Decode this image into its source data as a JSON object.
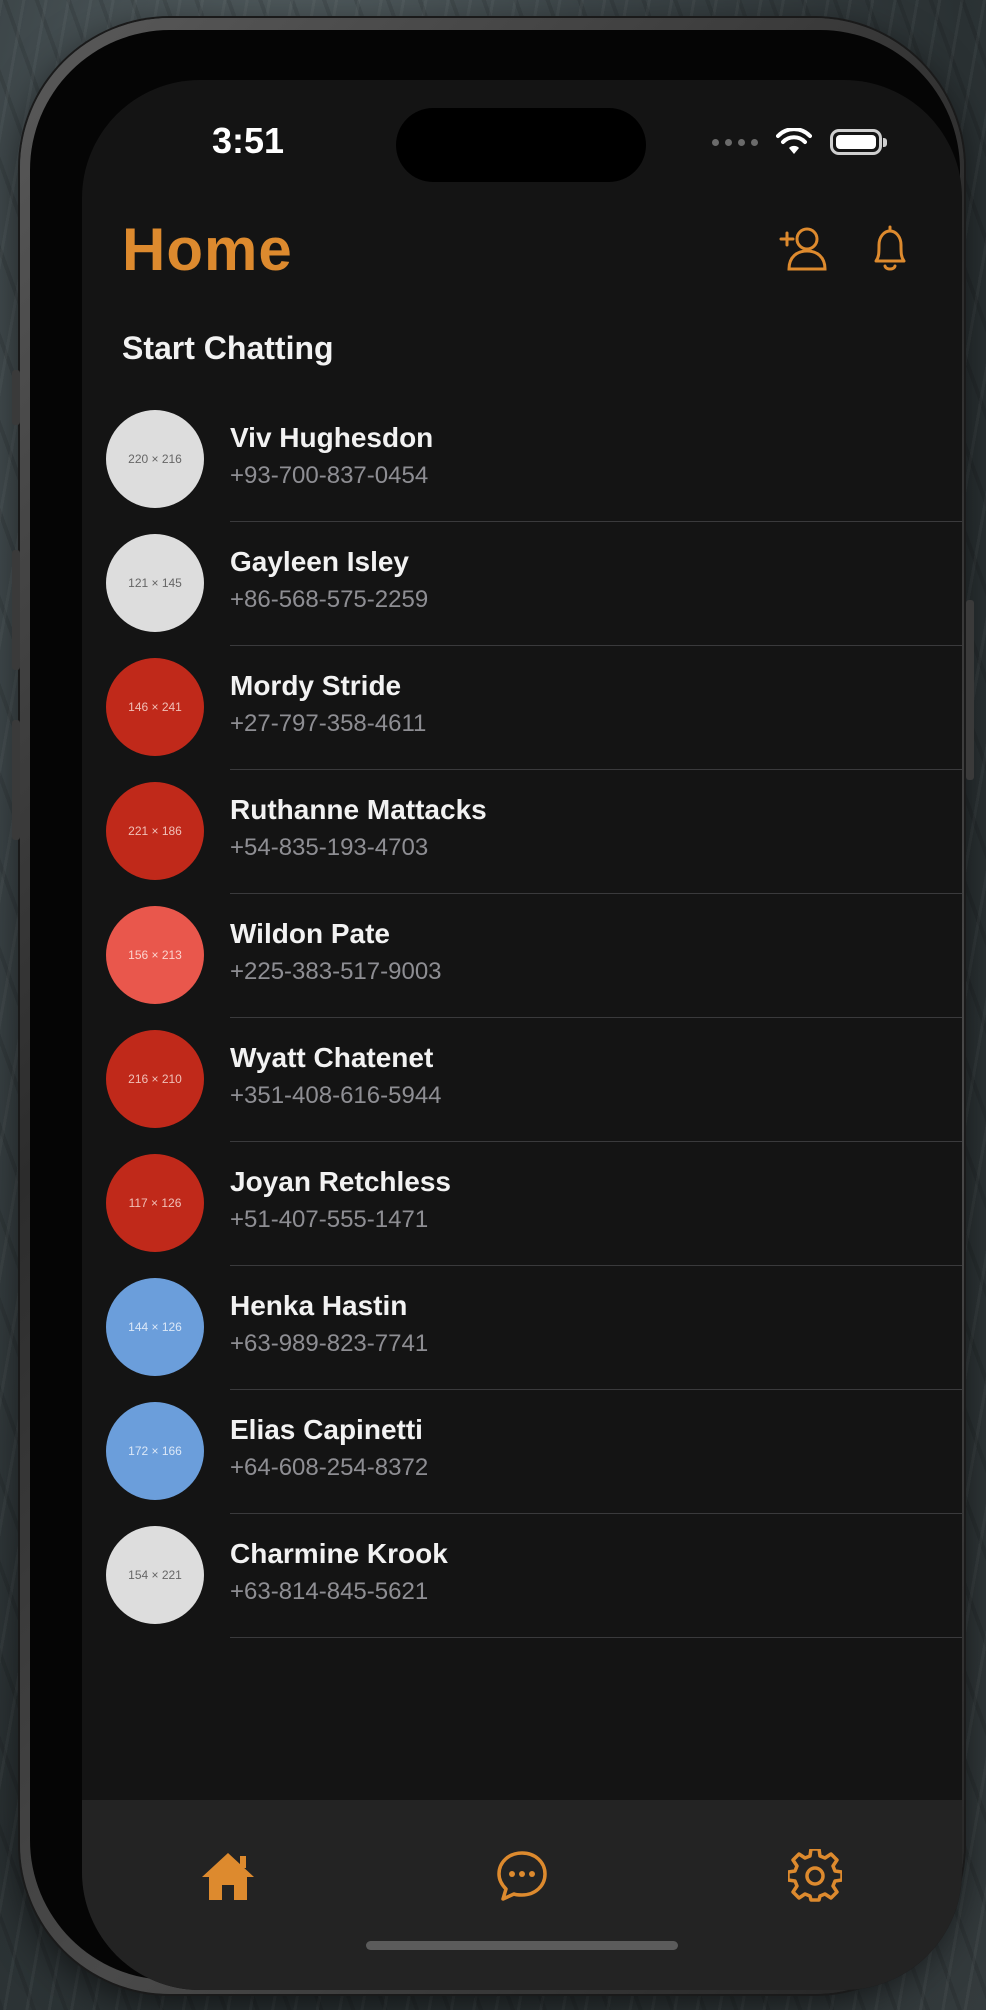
{
  "status_bar": {
    "time": "3:51"
  },
  "header": {
    "title": "Home",
    "icons": [
      "add-person-icon",
      "bell-icon"
    ],
    "accent_color": "#DD8A2E"
  },
  "section": {
    "title": "Start Chatting"
  },
  "contacts": [
    {
      "name": "Viv Hughesdon",
      "phone": "+93-700-837-0454",
      "avatar_label": "220 × 216",
      "avatar_color": "#DDDDDD",
      "avatar_text_color": "#666666"
    },
    {
      "name": "Gayleen Isley",
      "phone": "+86-568-575-2259",
      "avatar_label": "121 × 145",
      "avatar_color": "#DDDDDD",
      "avatar_text_color": "#666666"
    },
    {
      "name": "Mordy Stride",
      "phone": "+27-797-358-4611",
      "avatar_label": "146 × 241",
      "avatar_color": "#C0291A",
      "avatar_text_color": "#F0C0B8"
    },
    {
      "name": "Ruthanne Mattacks",
      "phone": "+54-835-193-4703",
      "avatar_label": "221 × 186",
      "avatar_color": "#C0291A",
      "avatar_text_color": "#F0C0B8"
    },
    {
      "name": "Wildon Pate",
      "phone": "+225-383-517-9003",
      "avatar_label": "156 × 213",
      "avatar_color": "#E9574C",
      "avatar_text_color": "#FBD4CF"
    },
    {
      "name": "Wyatt Chatenet",
      "phone": "+351-408-616-5944",
      "avatar_label": "216 × 210",
      "avatar_color": "#C0291A",
      "avatar_text_color": "#F0C0B8"
    },
    {
      "name": "Joyan Retchless",
      "phone": "+51-407-555-1471",
      "avatar_label": "117 × 126",
      "avatar_color": "#C0291A",
      "avatar_text_color": "#F0C0B8"
    },
    {
      "name": "Henka Hastin",
      "phone": "+63-989-823-7741",
      "avatar_label": "144 × 126",
      "avatar_color": "#6B9EDB",
      "avatar_text_color": "#DCE8F7"
    },
    {
      "name": "Elias Capinetti",
      "phone": "+64-608-254-8372",
      "avatar_label": "172 × 166",
      "avatar_color": "#6B9EDB",
      "avatar_text_color": "#DCE8F7"
    },
    {
      "name": "Charmine Krook",
      "phone": "+63-814-845-5621",
      "avatar_label": "154 × 221",
      "avatar_color": "#DDDDDD",
      "avatar_text_color": "#666666"
    }
  ],
  "tab_bar": {
    "tabs": [
      {
        "icon": "home-icon",
        "selected": true
      },
      {
        "icon": "chat-bubble-icon",
        "selected": false
      },
      {
        "icon": "gear-icon",
        "selected": false
      }
    ]
  }
}
